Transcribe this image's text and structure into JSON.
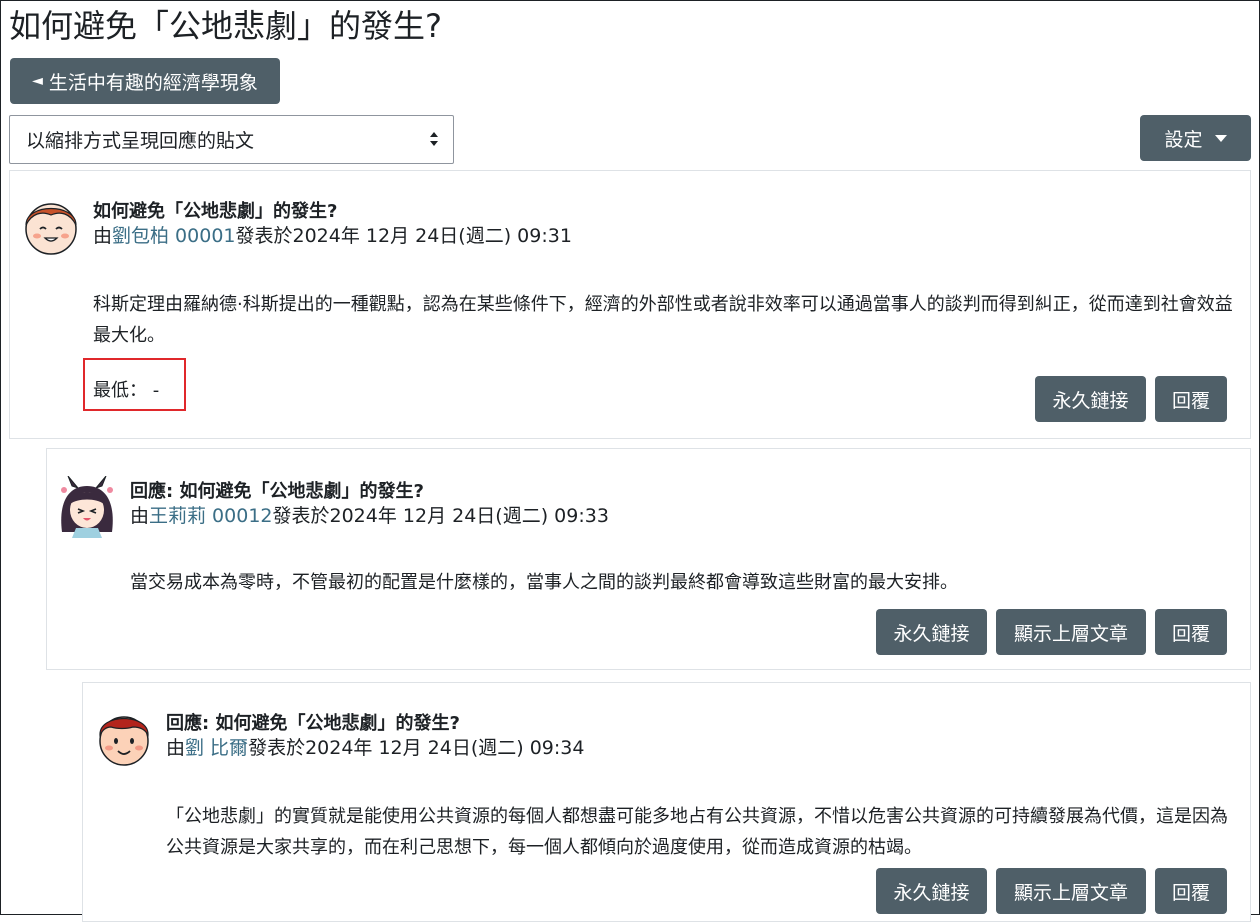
{
  "page": {
    "title": "如何避免「公地悲劇」的發生?",
    "back_label": "生活中有趣的經濟學現象",
    "display_mode": "以縮排方式呈現回應的貼文",
    "settings_label": "設定"
  },
  "posts": [
    {
      "subject": "如何避免「公地悲劇」的發生?",
      "by_prefix": "由",
      "author": "劉包柏 00001",
      "posted": "發表於2024年 12月 24日(週二) 09:31",
      "body": "科斯定理由羅納德·科斯提出的一種觀點，認為在某些條件下，經濟的外部性或者說非效率可以通過當事人的談判而得到糾正，從而達到社會效益最大化。",
      "rating": "最低： -",
      "actions": [
        "永久鏈接",
        "回覆"
      ]
    },
    {
      "subject": "回應: 如何避免「公地悲劇」的發生?",
      "by_prefix": "由",
      "author": "王莉莉 00012",
      "posted": "發表於2024年 12月 24日(週二) 09:33",
      "body": "當交易成本為零時，不管最初的配置是什麼樣的，當事人之間的談判最終都會導致這些財富的最大安排。",
      "actions": [
        "永久鏈接",
        "顯示上層文章",
        "回覆"
      ]
    },
    {
      "subject": "回應: 如何避免「公地悲劇」的發生?",
      "by_prefix": "由",
      "author": "劉 比爾",
      "posted": "發表於2024年 12月 24日(週二) 09:34",
      "body": "「公地悲劇」的實質就是能使用公共資源的每個人都想盡可能多地占有公共資源，不惜以危害公共資源的可持續發展為代價，這是因為公共資源是大家共享的，而在利己思想下，每一個人都傾向於過度使用，從而造成資源的枯竭。",
      "actions": [
        "永久鏈接",
        "顯示上層文章",
        "回覆"
      ]
    }
  ]
}
